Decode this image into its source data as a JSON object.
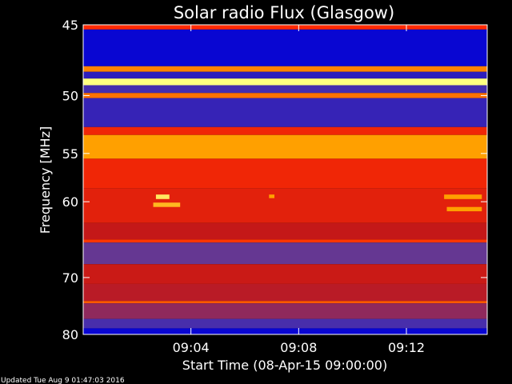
{
  "chart_data": {
    "type": "heatmap",
    "title": "Solar radio Flux (Glasgow)",
    "ylabel": "Frequency [MHz]",
    "xlabel": "Start Time (08-Apr-15 09:00:00)",
    "x_ticks": [
      "09:04",
      "09:08",
      "09:12"
    ],
    "x_tick_minutes": [
      4,
      8,
      12
    ],
    "xlim_minutes": [
      0,
      15
    ],
    "y_ticks": [
      "45",
      "50",
      "55",
      "60",
      "70",
      "80"
    ],
    "y_tick_values": [
      45,
      50,
      55,
      60,
      70,
      80
    ],
    "ylim_mhz": [
      45,
      80
    ],
    "y_scale": "reciprocal",
    "colormap": [
      "#0000d8",
      "#5a3aa0",
      "#c41818",
      "#ff2a00",
      "#ffa000",
      "#ffff80"
    ],
    "bands": [
      {
        "f_from": 45.0,
        "f_to": 45.3,
        "level": 0.6
      },
      {
        "f_from": 45.3,
        "f_to": 47.8,
        "level": 0.02
      },
      {
        "f_from": 47.8,
        "f_to": 48.2,
        "level": 0.75
      },
      {
        "f_from": 48.2,
        "f_to": 48.7,
        "level": 0.1
      },
      {
        "f_from": 48.7,
        "f_to": 49.2,
        "level": 1.0
      },
      {
        "f_from": 49.2,
        "f_to": 49.8,
        "level": 0.15
      },
      {
        "f_from": 49.8,
        "f_to": 50.2,
        "level": 0.72
      },
      {
        "f_from": 50.2,
        "f_to": 52.6,
        "level": 0.12
      },
      {
        "f_from": 52.6,
        "f_to": 53.3,
        "level": 0.55
      },
      {
        "f_from": 53.3,
        "f_to": 55.5,
        "level": 0.8
      },
      {
        "f_from": 55.5,
        "f_to": 58.5,
        "level": 0.55
      },
      {
        "f_from": 58.5,
        "f_to": 62.5,
        "level": 0.5
      },
      {
        "f_from": 62.5,
        "f_to": 64.6,
        "level": 0.4
      },
      {
        "f_from": 64.6,
        "f_to": 65.0,
        "level": 0.62
      },
      {
        "f_from": 65.0,
        "f_to": 68.0,
        "level": 0.22
      },
      {
        "f_from": 68.0,
        "f_to": 71.0,
        "level": 0.42
      },
      {
        "f_from": 71.0,
        "f_to": 73.8,
        "level": 0.38
      },
      {
        "f_from": 73.8,
        "f_to": 74.2,
        "level": 0.68
      },
      {
        "f_from": 74.2,
        "f_to": 77.0,
        "level": 0.3
      },
      {
        "f_from": 77.0,
        "f_to": 78.8,
        "level": 0.16
      },
      {
        "f_from": 78.8,
        "f_to": 80.0,
        "level": 0.02
      }
    ],
    "bursts": [
      {
        "t_from": 2.7,
        "t_to": 3.2,
        "f_from": 59.2,
        "f_to": 59.7,
        "level": 0.95
      },
      {
        "t_from": 2.6,
        "t_to": 3.6,
        "f_from": 60.1,
        "f_to": 60.6,
        "level": 0.85
      },
      {
        "t_from": 6.9,
        "t_to": 7.1,
        "f_from": 59.2,
        "f_to": 59.6,
        "level": 0.8
      },
      {
        "t_from": 13.4,
        "t_to": 14.8,
        "f_from": 59.2,
        "f_to": 59.7,
        "level": 0.8
      },
      {
        "t_from": 13.5,
        "t_to": 14.8,
        "f_from": 60.6,
        "f_to": 61.1,
        "level": 0.8
      }
    ]
  },
  "footer": {
    "updated": "Updated Tue Aug  9 01:47:03 2016"
  }
}
